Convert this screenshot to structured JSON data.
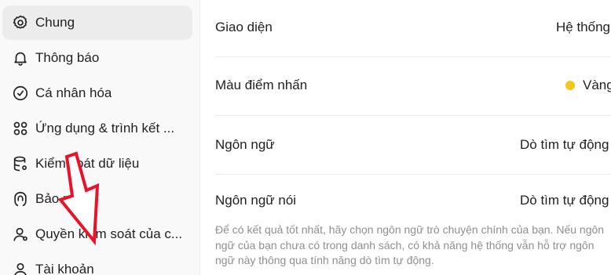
{
  "sidebar": {
    "items": [
      {
        "label": "Chung",
        "icon": "gear-icon",
        "active": true
      },
      {
        "label": "Thông báo",
        "icon": "bell-icon"
      },
      {
        "label": "Cá nhân hóa",
        "icon": "personalize-icon"
      },
      {
        "label": "Ứng dụng & trình kết ...",
        "icon": "apps-grid-icon"
      },
      {
        "label": "Kiểm soát dữ liệu",
        "icon": "database-icon"
      },
      {
        "label": "Bảo mật",
        "icon": "security-icon"
      },
      {
        "label": "Quyền kiểm soát của c...",
        "icon": "user-icon"
      },
      {
        "label": "Tài khoản",
        "icon": "account-icon"
      }
    ]
  },
  "settings": {
    "theme": {
      "label": "Giao diện",
      "value": "Hệ thống"
    },
    "accent": {
      "label": "Màu điểm nhấn",
      "value": "Vàng",
      "dot_color": "#f5c518"
    },
    "language": {
      "label": "Ngôn ngữ",
      "value": "Dò tìm tự động"
    },
    "spoken_language": {
      "label": "Ngôn ngữ nói",
      "value": "Dò tìm tự động"
    },
    "help_text": "Để có kết quả tốt nhất, hãy chọn ngôn ngữ trò chuyện chính của bạn. Nếu ngôn ngữ của bạn chưa có trong danh sách, có khả năng hệ thống vẫn hỗ trợ ngôn ngữ này thông qua tính năng dò tìm tự động."
  },
  "annotation": {
    "arrow_color": "#e8132a"
  }
}
